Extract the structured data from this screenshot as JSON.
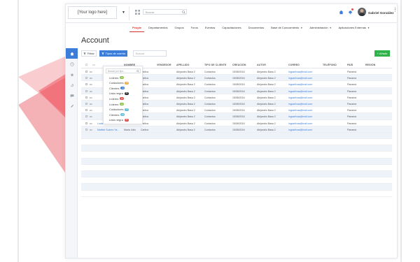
{
  "header": {
    "logo_text": "[Your logo here]",
    "search_placeholder": "Buscar",
    "user_name": "Gabriel González"
  },
  "nav": {
    "items": [
      {
        "label": "People",
        "active": true
      },
      {
        "label": "Departamentos"
      },
      {
        "label": "Grupos"
      },
      {
        "label": "Foros"
      },
      {
        "label": "Eventos"
      },
      {
        "label": "Capacitaciones"
      },
      {
        "label": "Documentos"
      },
      {
        "label": "Base de Conocimiento",
        "caret": true
      },
      {
        "label": "Administración",
        "caret": true
      },
      {
        "label": "Aplicaciones Externas",
        "caret": true
      }
    ]
  },
  "page": {
    "title": "Account"
  },
  "toolbar": {
    "filter_label": "Filtrar",
    "tipo_label": "Tipos de cuenta",
    "search_placeholder": "Buscar",
    "add_label": "+ Añadir"
  },
  "dropdown": {
    "search_placeholder": "Buscar por tipo...",
    "items": [
      {
        "label": "Líderes",
        "badge": "12",
        "color": "#8bc34a"
      },
      {
        "label": "Cuidadores",
        "badge": "11",
        "color": "#f0ad4e"
      },
      {
        "label": "Clientes",
        "badge": "12",
        "color": "#3b7dd8"
      },
      {
        "label": "Lista negra",
        "badge": "14",
        "color": "#333333"
      },
      {
        "label": "Líderes",
        "badge": "11",
        "color": "#d9534f"
      },
      {
        "label": "Líderes",
        "badge": "12",
        "color": "#8bc34a"
      },
      {
        "label": "Cuidadores",
        "badge": "11",
        "color": "#5bc0de"
      },
      {
        "label": "Clientes",
        "badge": "12",
        "color": "#5bc0de"
      },
      {
        "label": "Lista negra",
        "badge": "13",
        "color": "#d9534f"
      }
    ]
  },
  "table": {
    "columns": [
      "NOMBRE",
      "APELLIDO",
      "VENDEDOR",
      "TIPO DE CLIENTE",
      "CREACIÓN",
      "AUTOR",
      "CORREO",
      "TELÉFONO",
      "PAÍS",
      "REGIÓN"
    ],
    "rows": [
      {
        "nombre": "",
        "nombre2": "a",
        "apellido": "Carliva",
        "vendedor": "Alejandro Basa 2",
        "tipo": "Contactos",
        "creacion": "15/08/2016",
        "autor": "Alejandro Basa 2",
        "correo": "ingcarlivaa@mail.com",
        "telefono": "",
        "pais": "Panamá",
        "region": ""
      },
      {
        "nombre": "",
        "nombre2": "a",
        "apellido": "Carliva",
        "vendedor": "Alejandro Basa 2",
        "tipo": "Contactos",
        "creacion": "15/08/2016",
        "autor": "Alejandro Basa 2",
        "correo": "ingcarlivaa@mail.com",
        "telefono": "",
        "pais": "Panamá",
        "region": ""
      },
      {
        "nombre": "",
        "nombre2": "a",
        "apellido": "Carliva",
        "vendedor": "Alejandro Basa 2",
        "tipo": "Contactos",
        "creacion": "15/08/2016",
        "autor": "Alejandro Basa 2",
        "correo": "ingcarlivaa@mail.com",
        "telefono": "",
        "pais": "Panamá",
        "region": ""
      },
      {
        "nombre": "",
        "nombre2": "a",
        "apellido": "Carliva",
        "vendedor": "Alejandro Basa 2",
        "tipo": "Contactos",
        "creacion": "15/08/2016",
        "autor": "Alejandro Basa 2",
        "correo": "ingcarlivaa@mail.com",
        "telefono": "",
        "pais": "Panamá",
        "region": ""
      },
      {
        "nombre": "",
        "nombre2": "a",
        "apellido": "Carliva",
        "vendedor": "Alejandro Basa 2",
        "tipo": "Contactos",
        "creacion": "15/08/2016",
        "autor": "Alejandro Basa 2",
        "correo": "ingcarlivaa@mail.com",
        "telefono": "",
        "pais": "Panamá",
        "region": ""
      },
      {
        "nombre": "",
        "nombre2": "a",
        "apellido": "Carliva",
        "vendedor": "Alejandro Basa 2",
        "tipo": "Contactos",
        "creacion": "15/08/2016",
        "autor": "Alejandro Basa 2",
        "correo": "ingcarlivaa@mail.com",
        "telefono": "",
        "pais": "Panamá",
        "region": ""
      },
      {
        "nombre": "",
        "nombre2": "a",
        "apellido": "Carliva",
        "vendedor": "Alejandro Basa 2",
        "tipo": "Contactos",
        "creacion": "15/08/2016",
        "autor": "Alejandro Basa 2",
        "correo": "ingcarlivaa@mail.com",
        "telefono": "",
        "pais": "Panamá",
        "region": ""
      },
      {
        "nombre": "",
        "nombre2": "a",
        "apellido": "Carliva",
        "vendedor": "Alejandro Basa 2",
        "tipo": "Contactos",
        "creacion": "15/08/2016",
        "autor": "Alejandro Basa 2",
        "correo": "ingcarlivaa@mail.com",
        "telefono": "",
        "pais": "Panamá",
        "region": ""
      },
      {
        "nombre": "Lucia Maria Luis",
        "nombre2": "",
        "apellido": "Carliva",
        "vendedor": "Alejandro Basa 2",
        "tipo": "Contactos",
        "creacion": "15/08/2016",
        "autor": "Alejandro Basa 2",
        "correo": "ingcarlivaa@mail.com",
        "telefono": "",
        "pais": "Panamá",
        "region": ""
      },
      {
        "nombre": "Matilde Suárez Ya...",
        "nombre2": "Maria Julio",
        "apellido": "Carliva",
        "vendedor": "Alejandro Basa 2",
        "tipo": "Contactos",
        "creacion": "15/08/2016",
        "autor": "Alejandro Basa 2",
        "correo": "ingcarlivaa@mail.com",
        "telefono": "",
        "pais": "Panamá",
        "region": ""
      }
    ]
  },
  "colors": {
    "accent": "#3b7dd8",
    "brand_red": "#d9322b",
    "add_green": "#2eb34a"
  }
}
